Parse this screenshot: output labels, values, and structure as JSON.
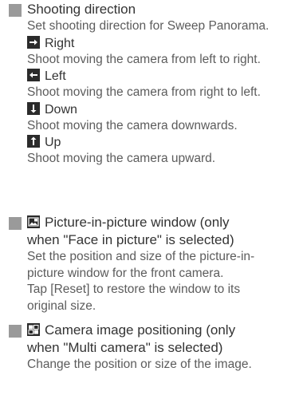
{
  "sections": [
    {
      "title": "Shooting direction",
      "description": "Set shooting direction for Sweep Panorama.",
      "options": [
        {
          "label": "Right",
          "icon": "arrow-right-icon",
          "description": "Shoot moving the camera from left to right."
        },
        {
          "label": "Left",
          "icon": "arrow-left-icon",
          "description": "Shoot moving the camera from right to left."
        },
        {
          "label": "Down",
          "icon": "arrow-down-icon",
          "description": "Shoot moving the camera downwards."
        },
        {
          "label": "Up",
          "icon": "arrow-up-icon",
          "description": "Shoot moving the camera upward."
        }
      ]
    },
    {
      "title_line1": "Picture-in-picture window (only",
      "title_line2": "when \"Face in picture\" is selected)",
      "icon": "picture-in-picture-icon",
      "description_lines": [
        "Set the position and size of the picture-in-",
        "picture window for the front camera.",
        "Tap [Reset] to restore the window to its",
        "original size."
      ]
    },
    {
      "title_line1": "Camera image positioning (only",
      "title_line2": "when \"Multi camera\" is selected)",
      "icon": "multi-camera-layout-icon",
      "description_lines": [
        "Change the position or size of the image."
      ]
    }
  ],
  "colors": {
    "icon_bg": "#2b2b2b",
    "icon_fg": "#ffffff",
    "section_marker": "#9a9a9a",
    "heading_text": "#333333",
    "body_text": "#5c5c5c"
  }
}
